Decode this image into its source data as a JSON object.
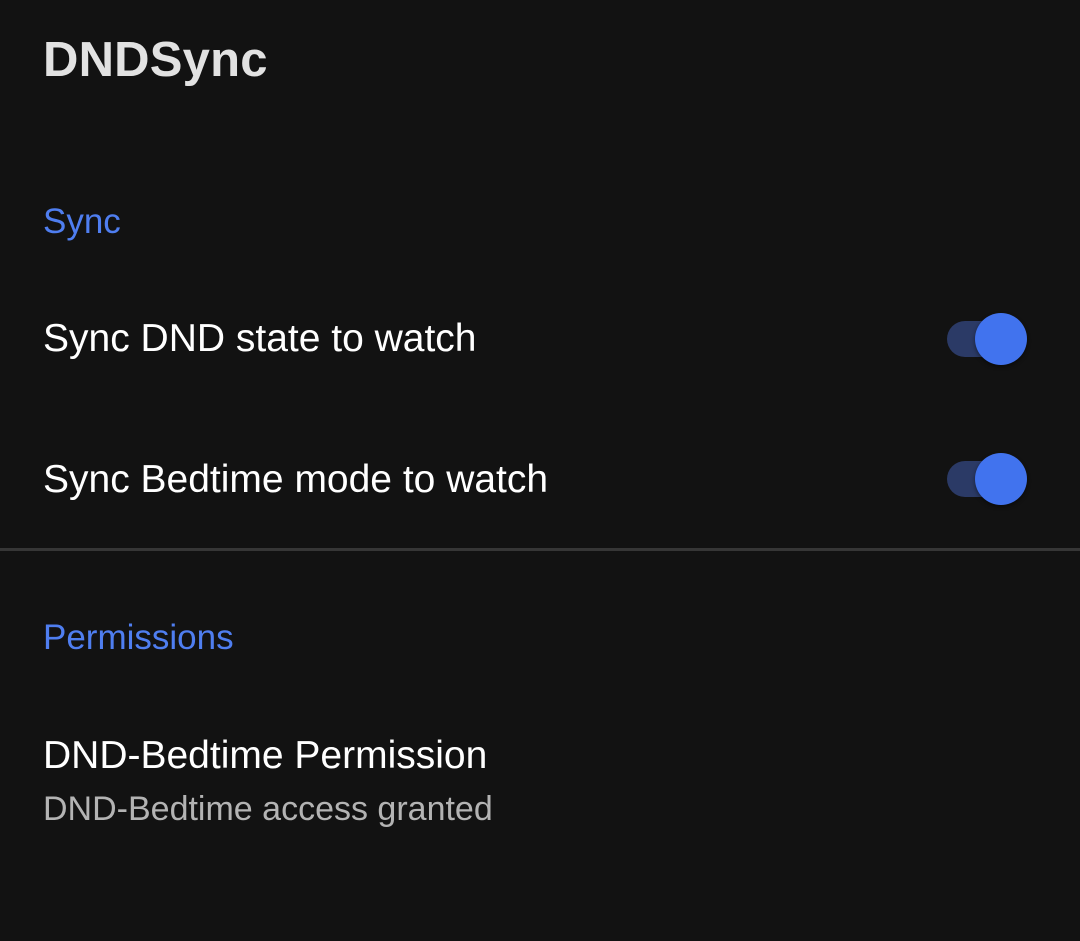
{
  "app_bar": {
    "title": "DNDSync"
  },
  "sync_category": {
    "title": "Sync",
    "items": [
      {
        "title": "Sync DND state to watch",
        "switch_on": true
      },
      {
        "title": "Sync Bedtime mode to watch",
        "switch_on": true
      }
    ]
  },
  "permissions_category": {
    "title": "Permissions",
    "items": [
      {
        "title": "DND-Bedtime Permission",
        "summary": "DND-Bedtime access granted"
      }
    ]
  },
  "colors": {
    "background": "#121212",
    "accent": "#4f7ef0",
    "switch_thumb": "#4173ee",
    "switch_track": "#2b3a66",
    "divider": "#363636"
  }
}
